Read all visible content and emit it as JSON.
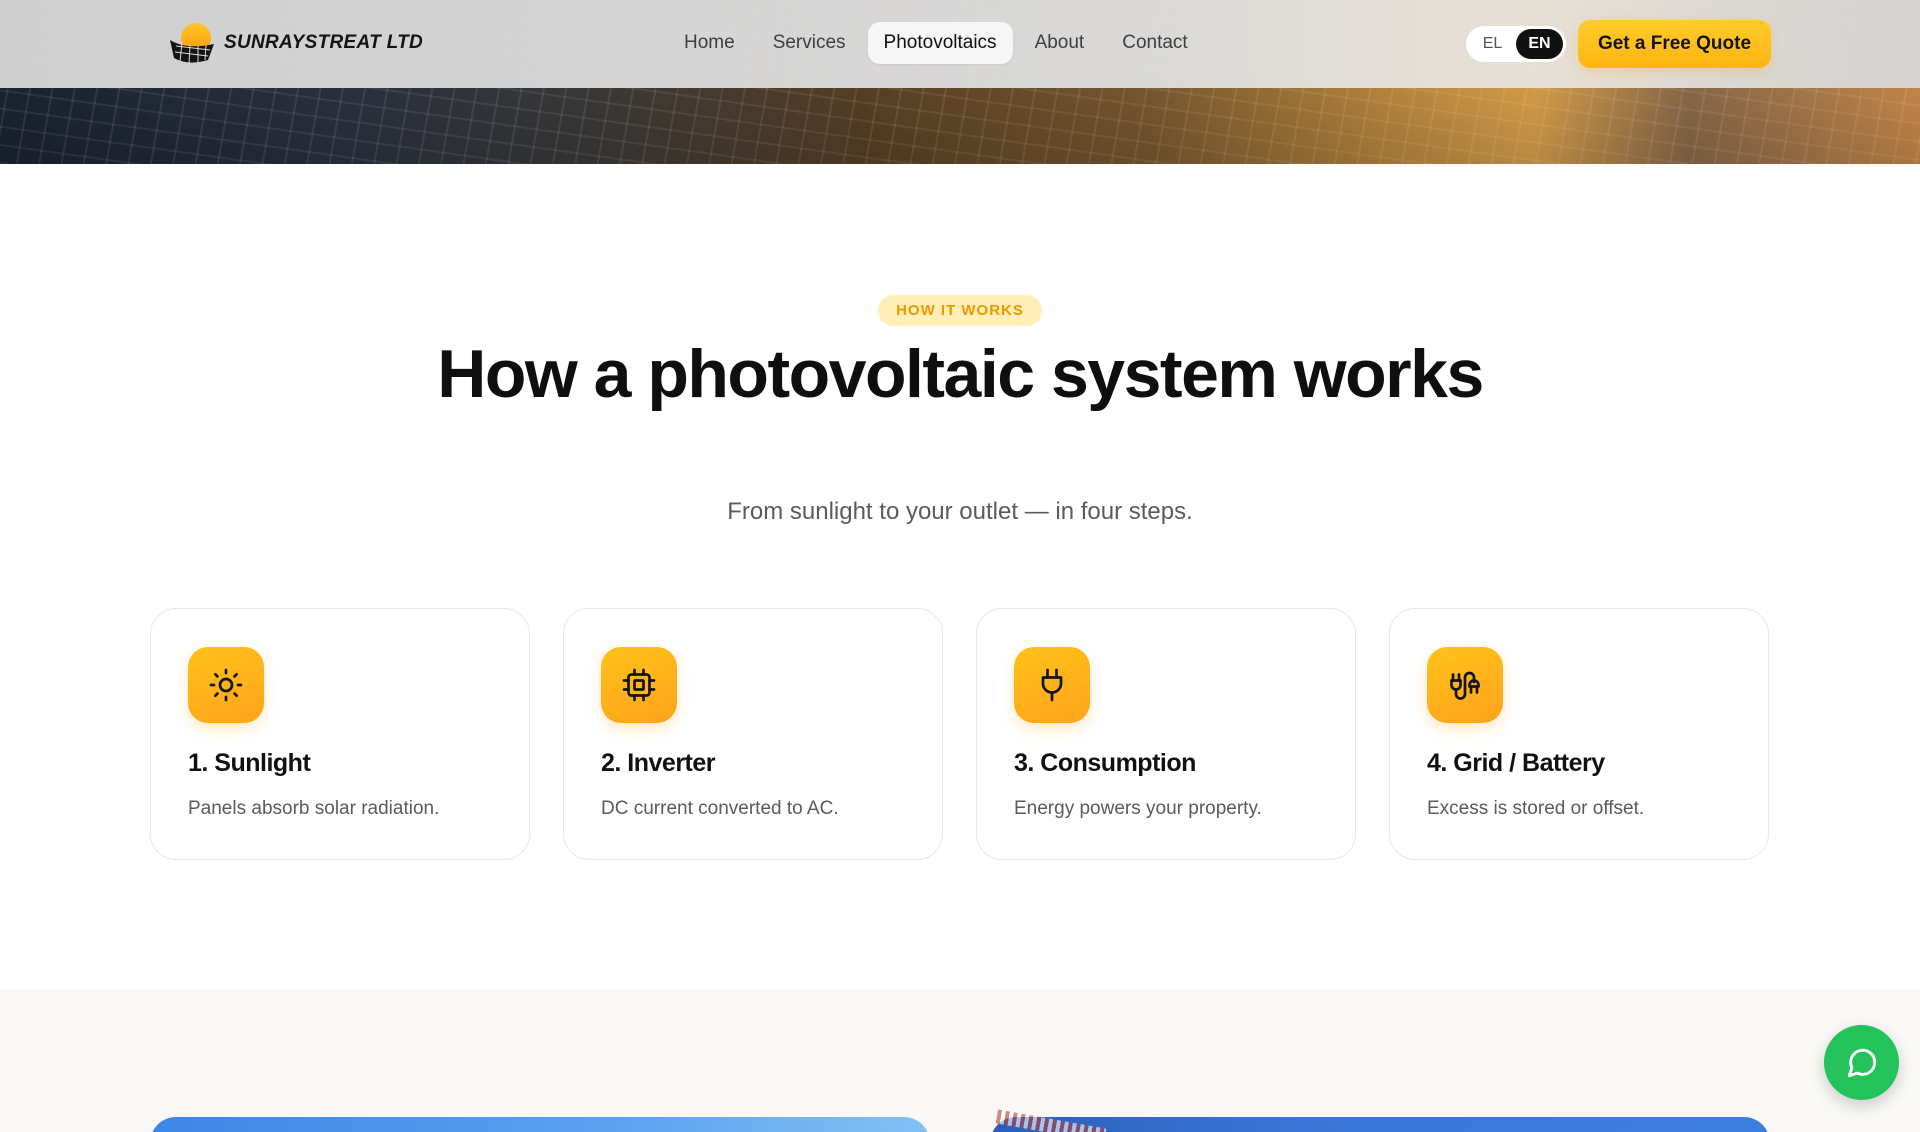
{
  "brand": {
    "name": "SUNRAYSTREAT LTD"
  },
  "nav": {
    "items": [
      {
        "label": "Home",
        "active": false
      },
      {
        "label": "Services",
        "active": false
      },
      {
        "label": "Photovoltaics",
        "active": true
      },
      {
        "label": "About",
        "active": false
      },
      {
        "label": "Contact",
        "active": false
      }
    ]
  },
  "language": {
    "options": [
      "EL",
      "EN"
    ],
    "selected": "EN"
  },
  "cta": {
    "label": "Get a Free Quote"
  },
  "how_it_works": {
    "badge": "HOW IT WORKS",
    "title": "How a photovoltaic system works",
    "subtitle": "From sunlight to your outlet — in four steps.",
    "steps": [
      {
        "title": "1. Sunlight",
        "description": "Panels absorb solar radiation.",
        "icon": "sun-icon"
      },
      {
        "title": "2. Inverter",
        "description": "DC current converted to AC.",
        "icon": "chip-icon"
      },
      {
        "title": "3. Consumption",
        "description": "Energy powers your property.",
        "icon": "plug-icon"
      },
      {
        "title": "4. Grid / Battery",
        "description": "Excess is stored or offset.",
        "icon": "cable-icon"
      }
    ]
  },
  "chat": {
    "icon": "chat-bubble-icon"
  },
  "colors": {
    "accent": "#ffb412",
    "chat": "#23c25a",
    "badge_bg": "#ffeeb5",
    "badge_text": "#e99a00"
  }
}
